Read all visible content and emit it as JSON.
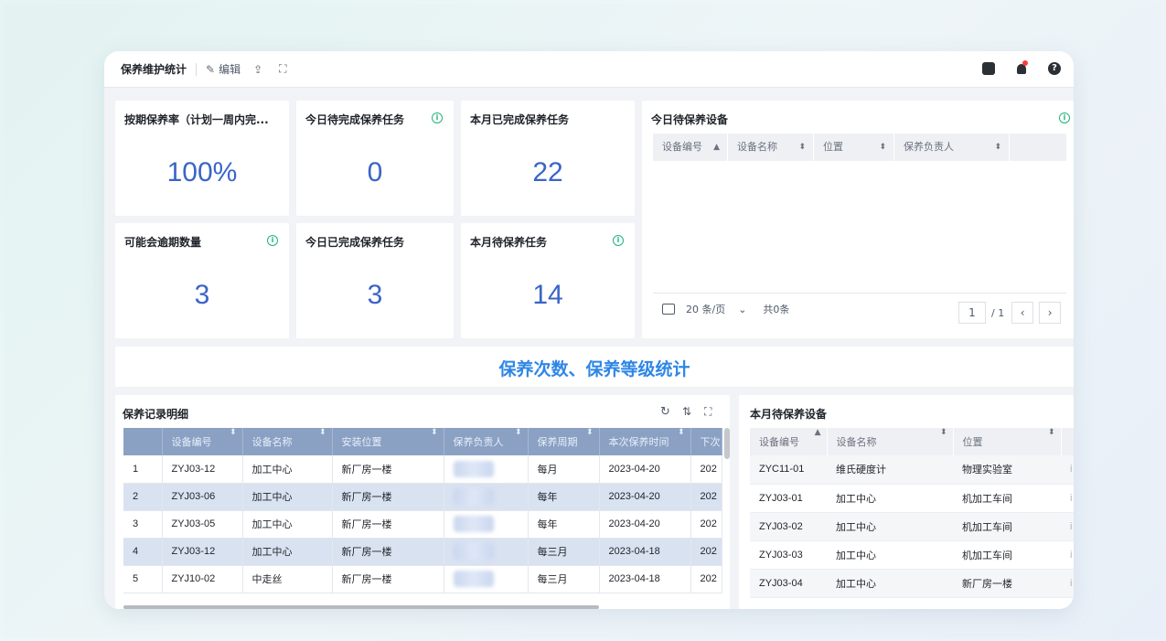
{
  "toolbar": {
    "title": "保养维护统计",
    "edit_label": "编辑",
    "edit_icon": "pencil-icon",
    "export_icon": "upload-icon",
    "fullscreen_icon": "fullscreen-icon",
    "right_icons": [
      "panel-icon",
      "bell-icon",
      "help-icon"
    ],
    "help_glyph": "?"
  },
  "kpis": [
    {
      "label": "按期保养率（计划一周内完...",
      "value": "100%",
      "info": false
    },
    {
      "label": "今日待完成保养任务",
      "value": "0",
      "info": true
    },
    {
      "label": "本月已完成保养任务",
      "value": "22",
      "info": false
    },
    {
      "label": "可能会逾期数量",
      "value": "3",
      "info": true
    },
    {
      "label": "今日已完成保养任务",
      "value": "3",
      "info": false
    },
    {
      "label": "本月待保养任务",
      "value": "14",
      "info": true
    }
  ],
  "info_glyph": "i",
  "today_devices": {
    "title": "今日待保养设备",
    "columns": [
      "设备编号",
      "设备名称",
      "位置",
      "保养负责人"
    ],
    "page_size": "20 条/页",
    "total": "共0条",
    "page_current": "1",
    "page_total": "/ 1",
    "prev": "‹",
    "next": "›",
    "dropdown_glyph": "⌄"
  },
  "banner": {
    "text": "保养次数、保养等级统计"
  },
  "records": {
    "title": "保养记录明细",
    "columns": [
      "",
      "设备编号",
      "设备名称",
      "安装位置",
      "保养负责人",
      "保养周期",
      "本次保养时间",
      "下次"
    ],
    "rows": [
      {
        "index": "1",
        "code": "ZYJ03-12",
        "name": "加工中心",
        "location": "新厂房一楼",
        "period": "每月",
        "time": "2023-04-20",
        "next": "202"
      },
      {
        "index": "2",
        "code": "ZYJ03-06",
        "name": "加工中心",
        "location": "新厂房一楼",
        "period": "每年",
        "time": "2023-04-20",
        "next": "202"
      },
      {
        "index": "3",
        "code": "ZYJ03-05",
        "name": "加工中心",
        "location": "新厂房一楼",
        "period": "每年",
        "time": "2023-04-20",
        "next": "202"
      },
      {
        "index": "4",
        "code": "ZYJ03-12",
        "name": "加工中心",
        "location": "新厂房一楼",
        "period": "每三月",
        "time": "2023-04-18",
        "next": "202"
      },
      {
        "index": "5",
        "code": "ZYJ10-02",
        "name": "中走丝",
        "location": "新厂房一楼",
        "period": "每三月",
        "time": "2023-04-18",
        "next": "202"
      }
    ]
  },
  "month_devices": {
    "title": "本月待保养设备",
    "columns": [
      "设备编号",
      "设备名称",
      "位置",
      ""
    ],
    "rows": [
      {
        "code": "ZYC11-01",
        "name": "维氏硬度计",
        "location": "物理实验室",
        "extra": "i"
      },
      {
        "code": "ZYJ03-01",
        "name": "加工中心",
        "location": "机加工车间",
        "extra": "i"
      },
      {
        "code": "ZYJ03-02",
        "name": "加工中心",
        "location": "机加工车间",
        "extra": "i"
      },
      {
        "code": "ZYJ03-03",
        "name": "加工中心",
        "location": "机加工车间",
        "extra": "i"
      },
      {
        "code": "ZYJ03-04",
        "name": "加工中心",
        "location": "新厂房一楼",
        "extra": "i"
      }
    ]
  },
  "colors": {
    "accent": "#3a64c8",
    "banner": "#2e86e6",
    "info": "#21b37a",
    "header_blue": "#8aa1c4",
    "row_alt": "#d9e2f1"
  }
}
